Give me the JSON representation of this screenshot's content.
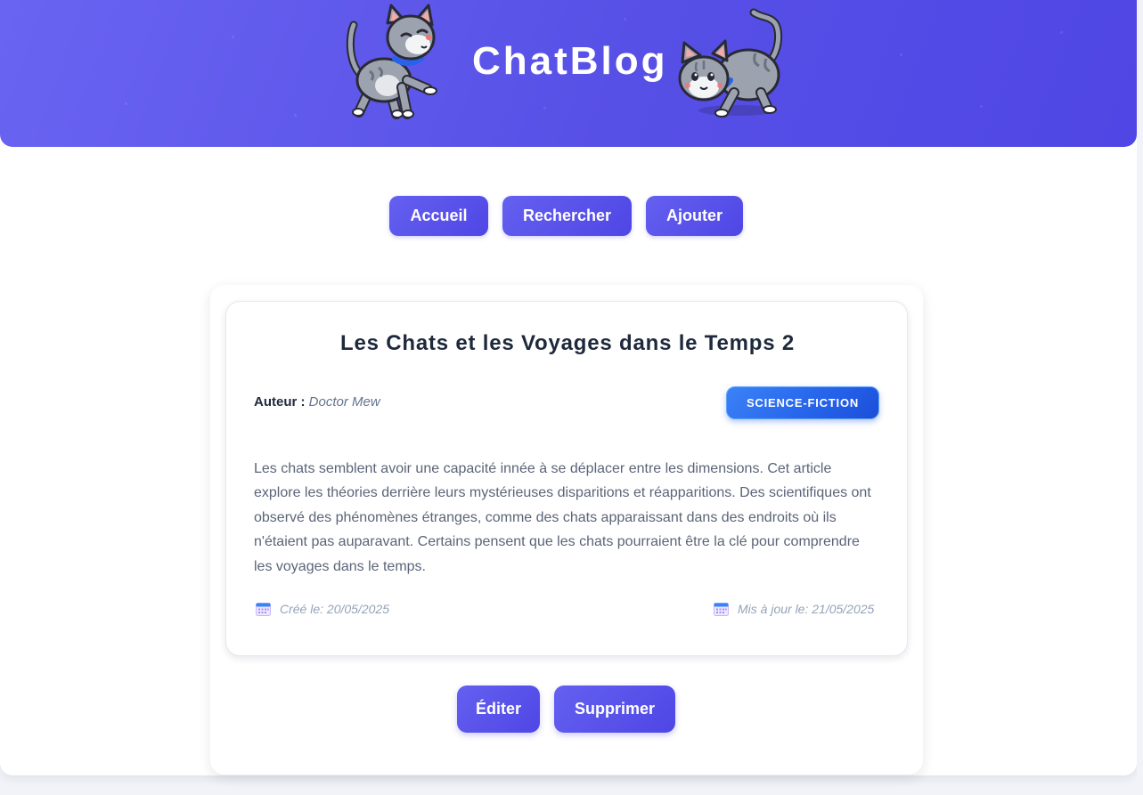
{
  "header": {
    "site_title": "ChatBlog"
  },
  "nav": {
    "home": "Accueil",
    "search": "Rechercher",
    "add": "Ajouter"
  },
  "article": {
    "title": "Les Chats et les Voyages dans le Temps 2",
    "author_label": "Auteur :",
    "author": "Doctor Mew",
    "category": "SCIENCE-FICTION",
    "body": "Les chats semblent avoir une capacité innée à se déplacer entre les dimensions. Cet article explore les théories derrière leurs mystérieuses disparitions et réapparitions. Des scientifiques ont observé des phénomènes étranges, comme des chats apparaissant dans des endroits où ils n'étaient pas auparavant. Certains pensent que les chats pourraient être la clé pour comprendre les voyages dans le temps.",
    "created": "Créé le: 20/05/2025",
    "updated": "Mis à jour le: 21/05/2025"
  },
  "actions": {
    "edit": "Éditer",
    "delete": "Supprimer"
  },
  "colors": {
    "header_gradient_start": "#6a64f2",
    "header_gradient_end": "#4f46e5",
    "button_primary": "#4f46e5",
    "badge_blue": "#2563eb",
    "title_text": "#1e293b",
    "body_text": "#5b6478",
    "meta_text": "#94a3b8"
  },
  "icons": {
    "header_left": "walking-cat-icon",
    "header_right": "crouching-cat-icon",
    "date": "calendar-icon"
  }
}
